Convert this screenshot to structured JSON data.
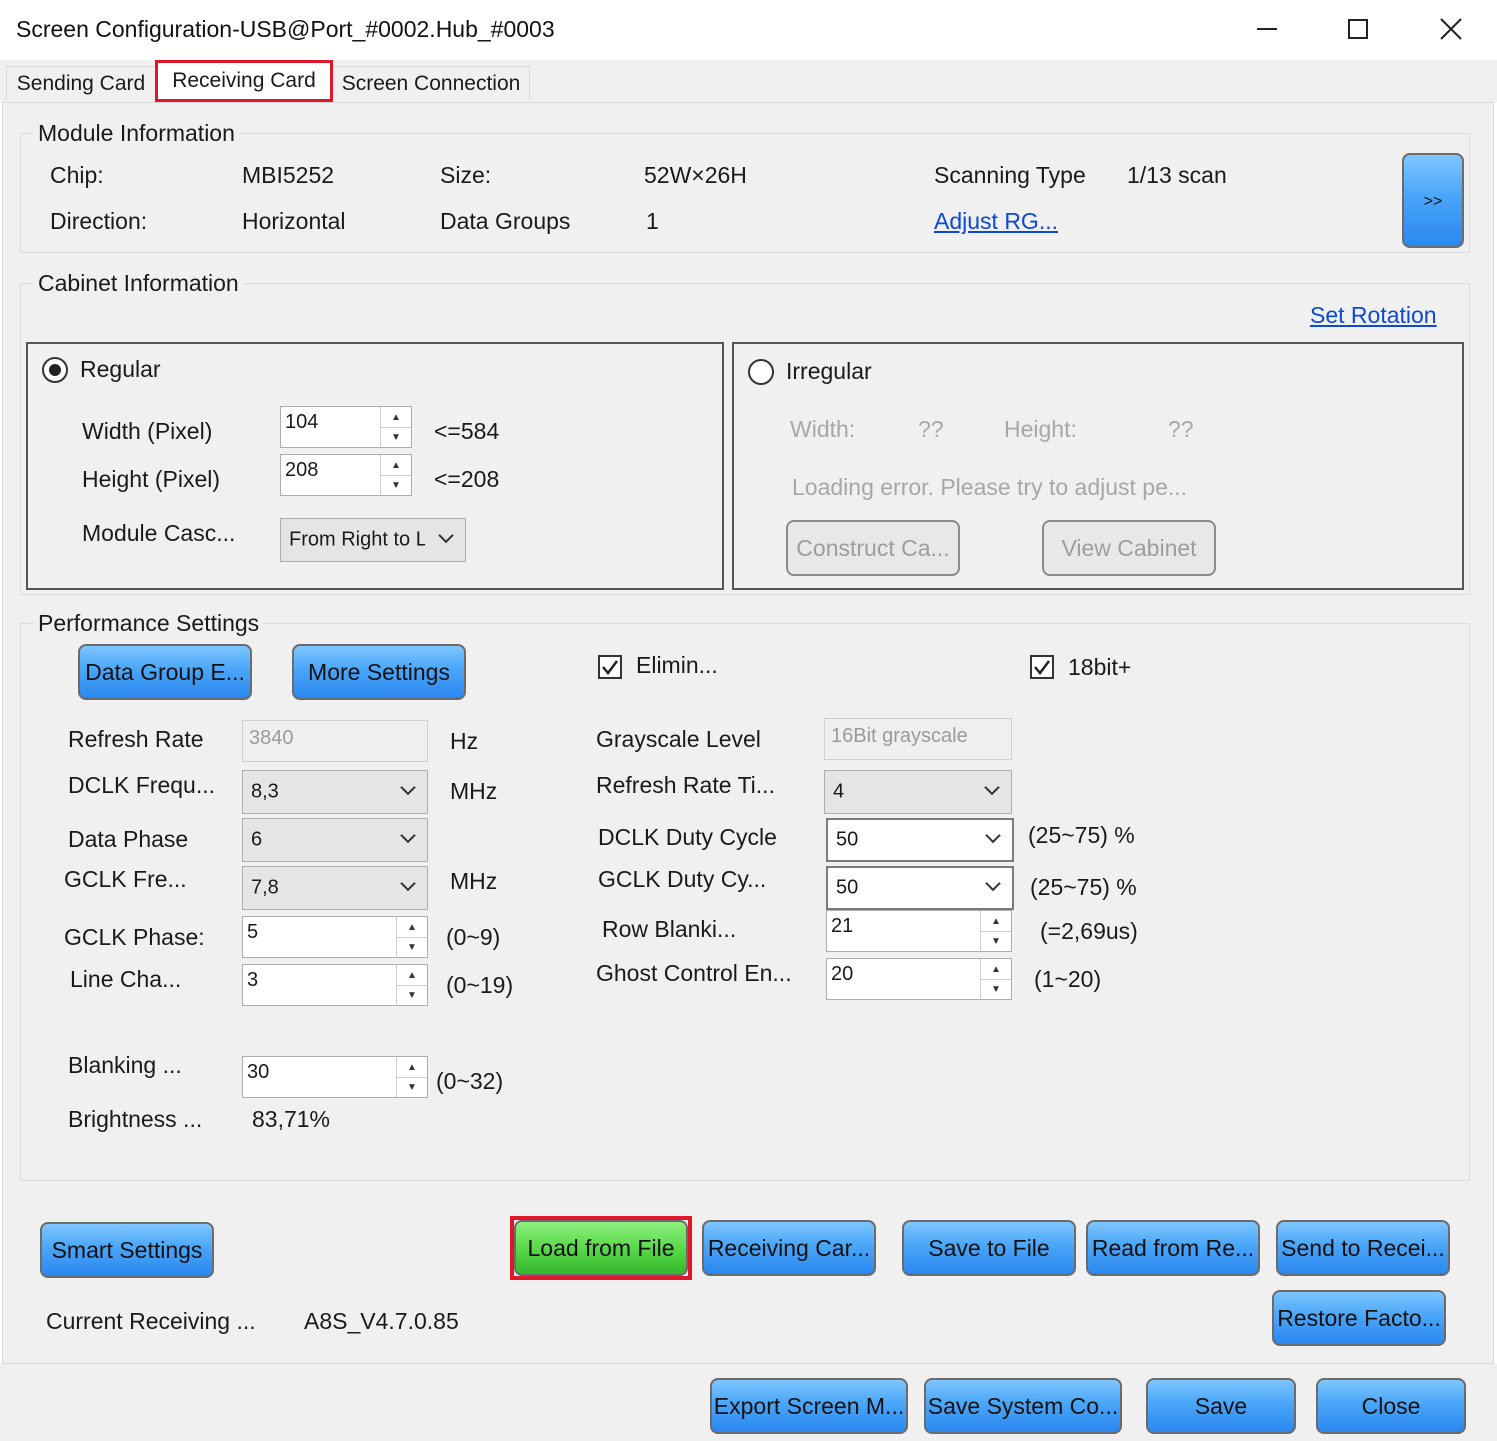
{
  "window": {
    "title": "Screen Configuration-USB@Port_#0002.Hub_#0003",
    "minimize_icon": "minimize-icon",
    "maximize_icon": "maximize-icon",
    "close_icon": "close-icon"
  },
  "tabs": [
    {
      "label": "Sending Card"
    },
    {
      "label": "Receiving Card",
      "active": true
    },
    {
      "label": "Screen Connection"
    }
  ],
  "module": {
    "group_label": "Module Information",
    "chip_label": "Chip:",
    "chip_value": "MBI5252",
    "size_label": "Size:",
    "size_value": "52W×26H",
    "scan_label": "Scanning Type",
    "scan_value": "1/13 scan",
    "direction_label": "Direction:",
    "direction_value": "Horizontal",
    "groups_label": "Data Groups",
    "groups_value": "1",
    "adjust_link": "Adjust RG...",
    "expand_button": ">>"
  },
  "cabinet": {
    "group_label": "Cabinet Information",
    "set_rotation": "Set Rotation",
    "regular_label": "Regular",
    "width_label": "Width (Pixel)",
    "width_value": "104",
    "width_max": "<=584",
    "height_label": "Height (Pixel)",
    "height_value": "208",
    "height_max": "<=208",
    "cascade_label": "Module Casc...",
    "cascade_value": "From Right to L",
    "irregular_label": "Irregular",
    "irr_width_label": "Width:",
    "irr_width_value": "??",
    "irr_height_label": "Height:",
    "irr_height_value": "??",
    "error_text": "Loading error. Please try to adjust pe...",
    "construct_button": "Construct Ca...",
    "view_button": "View Cabinet"
  },
  "performance": {
    "group_label": "Performance Settings",
    "data_group_button": "Data Group E...",
    "more_settings_button": "More Settings",
    "elim_label": "Elimin...",
    "bit18_label": "18bit+",
    "refresh_label": "Refresh Rate",
    "refresh_value": "3840",
    "refresh_unit": "Hz",
    "dclk_label": "DCLK Frequ...",
    "dclk_value": "8,3",
    "dclk_unit": "MHz",
    "phase_label": "Data Phase",
    "phase_value": "6",
    "gclk_label": "GCLK Fre...",
    "gclk_value": "7,8",
    "gclk_unit": "MHz",
    "gclk_phase_label": "GCLK Phase:",
    "gclk_phase_value": "5",
    "gclk_phase_range": "(0~9)",
    "line_label": "Line Cha...",
    "line_value": "3",
    "line_range": "(0~19)",
    "blanking_label": "Blanking ...",
    "blanking_value": "30",
    "blanking_range": "(0~32)",
    "brightness_label": "Brightness ...",
    "brightness_value": "83,71%",
    "grayscale_label": "Grayscale Level",
    "grayscale_value": "16Bit grayscale",
    "rrt_label": "Refresh Rate Ti...",
    "rrt_value": "4",
    "dclk_duty_label": "DCLK Duty Cycle",
    "dclk_duty_value": "50",
    "dclk_duty_range": "(25~75) %",
    "gclk_duty_label": "GCLK Duty Cy...",
    "gclk_duty_value": "50",
    "gclk_duty_range": "(25~75) %",
    "row_label": "Row Blanki...",
    "row_value": "21",
    "row_note": "(=2,69us)",
    "ghost_label": "Ghost Control En...",
    "ghost_value": "20",
    "ghost_range": "(1~20)"
  },
  "actions": {
    "smart_settings": "Smart Settings",
    "load_from_file": "Load from File",
    "receiving_card": "Receiving Car...",
    "save_to_file": "Save to File",
    "read_from": "Read from Re...",
    "send_to": "Send to Recei...",
    "restore": "Restore Facto...",
    "current_label": "Current Receiving ...",
    "current_value": "A8S_V4.7.0.85"
  },
  "footer": {
    "export": "Export Screen M...",
    "save_system": "Save System Co...",
    "save": "Save",
    "close": "Close"
  }
}
